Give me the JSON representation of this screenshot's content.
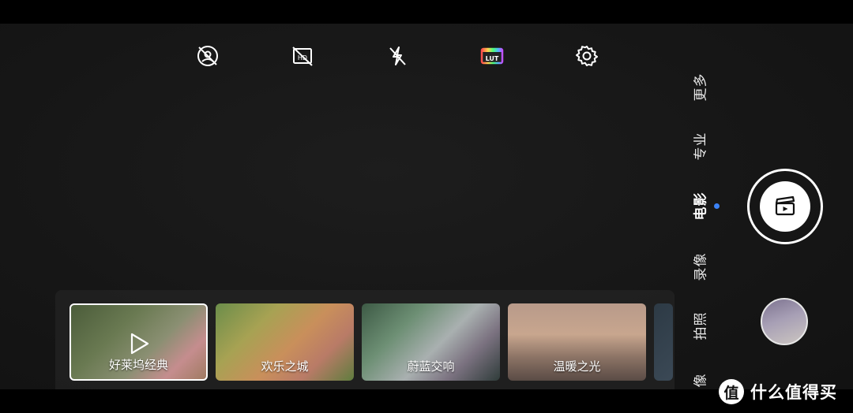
{
  "top_bar": {
    "icons": [
      "hdr-off-icon",
      "hd-off-icon",
      "flash-off-icon",
      "lut-icon",
      "gear-icon"
    ],
    "lut_label": "LUT"
  },
  "modes": {
    "items": [
      "更多",
      "专业",
      "电影",
      "录像",
      "拍照",
      "像"
    ],
    "active": "电影"
  },
  "filters": [
    {
      "label": "好莱坞经典",
      "selected": true
    },
    {
      "label": "欢乐之城",
      "selected": false
    },
    {
      "label": "蔚蓝交响",
      "selected": false
    },
    {
      "label": "温暖之光",
      "selected": false
    }
  ],
  "colors": {
    "accent_dot": "#3b82f6",
    "background": "#161616"
  },
  "watermark": {
    "badge": "值",
    "text": "什么值得买"
  }
}
